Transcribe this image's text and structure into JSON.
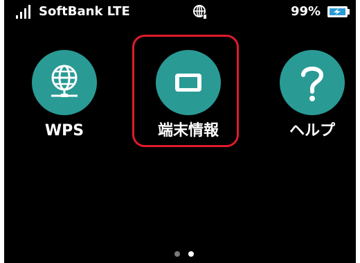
{
  "status_bar": {
    "carrier": "SoftBank LTE",
    "battery_percent": "99%",
    "signal_icon": "signal-strength-icon",
    "network_icon": "globe-status-icon",
    "battery_icon": "battery-charging-icon"
  },
  "menu": {
    "items": [
      {
        "label": "WPS",
        "icon": "globe-network-icon"
      },
      {
        "label": "端末情報",
        "icon": "device-info-icon",
        "highlighted": true
      },
      {
        "label": "ヘルプ",
        "icon": "question-mark-icon"
      }
    ]
  },
  "pagination": {
    "total": 2,
    "current": 2
  },
  "colors": {
    "screen_background": "#000000",
    "icon_circle": "#2a9a95",
    "highlight_border": "#e11b2a",
    "text": "#ffffff"
  }
}
